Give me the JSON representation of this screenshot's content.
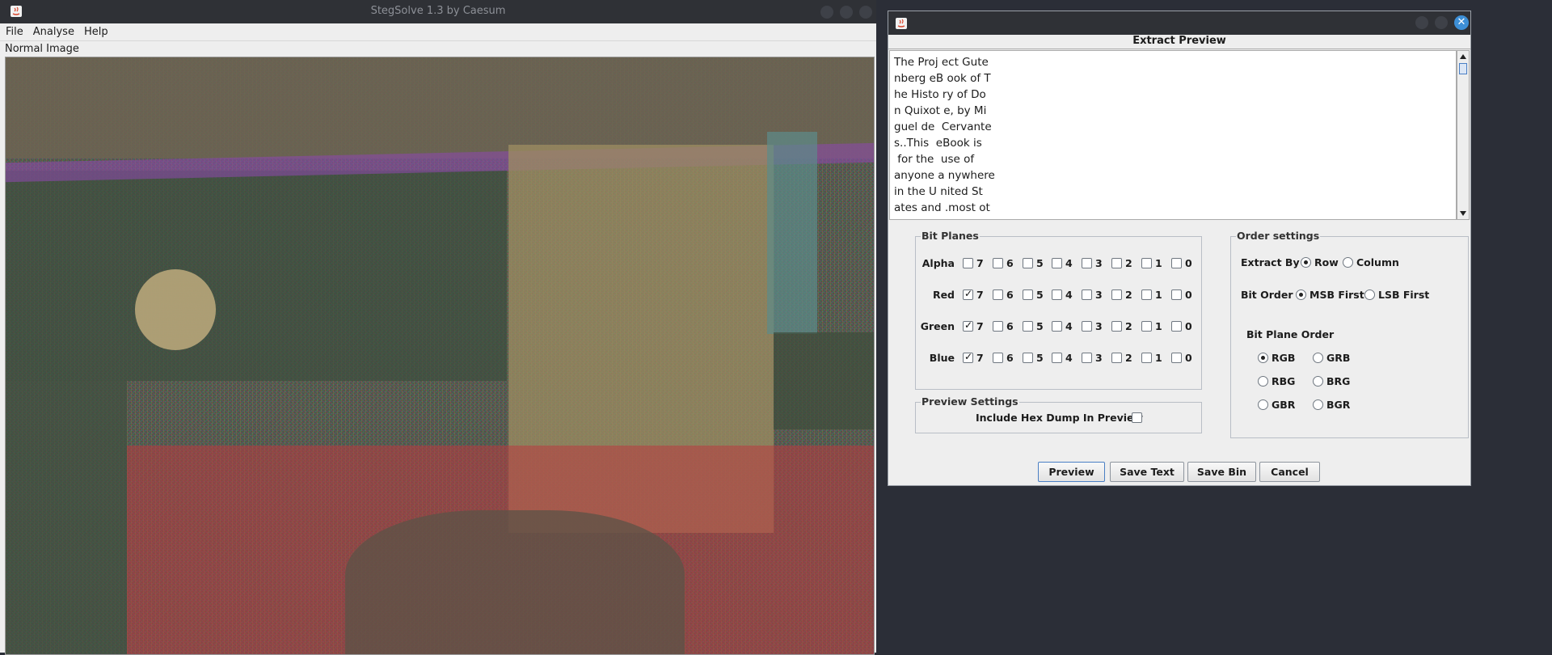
{
  "main_window": {
    "title": "StegSolve 1.3 by Caesum",
    "menu": [
      "File",
      "Analyse",
      "Help"
    ],
    "image_label": "Normal Image"
  },
  "dialog": {
    "caption": "Extract Preview",
    "preview_text": "The Proj ect Gute\nnberg eB ook of T\nhe Histo ry of Do\nn Quixot e, by Mi\nguel de  Cervante\ns..This  eBook is\n for the  use of\nanyone a nywhere\nin the U nited St\nates and .most ot",
    "bit_planes": {
      "legend": "Bit Planes",
      "bits": [
        "7",
        "6",
        "5",
        "4",
        "3",
        "2",
        "1",
        "0"
      ],
      "rows": [
        {
          "label": "Alpha",
          "checked": []
        },
        {
          "label": "Red",
          "checked": [
            "7"
          ]
        },
        {
          "label": "Green",
          "checked": [
            "7"
          ]
        },
        {
          "label": "Blue",
          "checked": [
            "7"
          ]
        }
      ]
    },
    "preview_settings": {
      "legend": "Preview Settings",
      "hex_dump_label": "Include Hex Dump In Preview",
      "hex_dump_checked": false
    },
    "order_settings": {
      "legend": "Order settings",
      "extract_by_label": "Extract By",
      "extract_by_options": [
        "Row",
        "Column"
      ],
      "extract_by_selected": "Row",
      "bit_order_label": "Bit Order",
      "bit_order_options": [
        "MSB First",
        "LSB First"
      ],
      "bit_order_selected": "MSB First",
      "bit_plane_order_label": "Bit Plane Order",
      "bit_plane_order_options": [
        "RGB",
        "GRB",
        "RBG",
        "BRG",
        "GBR",
        "BGR"
      ],
      "bit_plane_order_selected": "RGB"
    },
    "buttons": {
      "preview": "Preview",
      "save_text": "Save Text",
      "save_bin": "Save Bin",
      "cancel": "Cancel"
    }
  },
  "colors": {
    "desktop": "#2b2e37",
    "window_bg": "#eeeeee",
    "titlebar": "#2f3136",
    "close_button": "#3d8fd6"
  }
}
